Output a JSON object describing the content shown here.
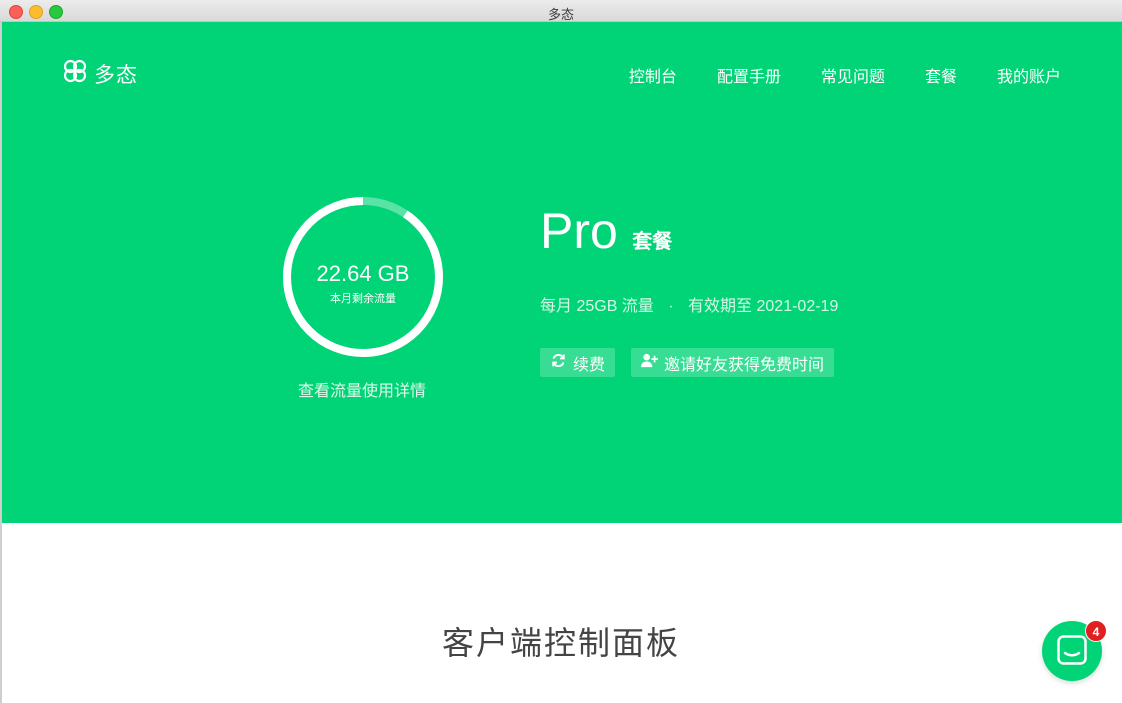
{
  "window": {
    "title": "多态"
  },
  "brand": {
    "name": "多态",
    "accent": "#00d477"
  },
  "nav": {
    "items": [
      {
        "label": "控制台"
      },
      {
        "label": "配置手册"
      },
      {
        "label": "常见问题"
      },
      {
        "label": "套餐"
      },
      {
        "label": "我的账户"
      }
    ]
  },
  "usage": {
    "remaining": "22.64 GB",
    "remaining_label": "本月剩余流量",
    "remaining_fraction": 0.906,
    "details_link": "查看流量使用详情"
  },
  "plan": {
    "name": "Pro",
    "suffix": "套餐",
    "quota": "每月 25GB 流量",
    "separator": "·",
    "expiry": "有效期至 2021-02-19",
    "renew_label": "续费",
    "invite_label": "邀请好友获得免费时间"
  },
  "section": {
    "title": "客户端控制面板"
  },
  "chat": {
    "badge": "4"
  }
}
